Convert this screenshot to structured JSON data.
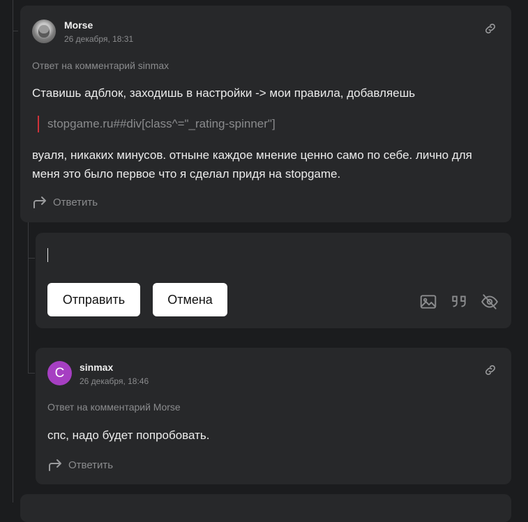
{
  "comment1": {
    "author": "Morse",
    "timestamp": "26 декабря, 18:31",
    "reply_to": "Ответ на комментарий sinmax",
    "text_top": "Ставишь адблок, заходишь в настройки -> мои правила, добавляешь",
    "quote": "stopgame.ru##div[class^=\"_rating-spinner\"]",
    "text_bottom_line1": "вуаля, никаких минусов. отныне каждое мнение ценно само по себе. лично для",
    "text_bottom_line2": "меня это было первое что я сделал придя на stopgame.",
    "reply_label": "Ответить",
    "icon": "link-icon"
  },
  "reply_form": {
    "input_value": "",
    "submit_label": "Отправить",
    "cancel_label": "Отмена",
    "icons": [
      "image-icon",
      "quote-icon",
      "spoiler-eye-icon"
    ]
  },
  "comment2": {
    "author": "sinmax",
    "avatar_letter": "C",
    "avatar_color": "#a63fc2",
    "timestamp": "26 декабря, 18:46",
    "reply_to": "Ответ на комментарий Morse",
    "text": "спс, надо будет попробовать.",
    "reply_label": "Ответить",
    "icon": "link-icon"
  }
}
